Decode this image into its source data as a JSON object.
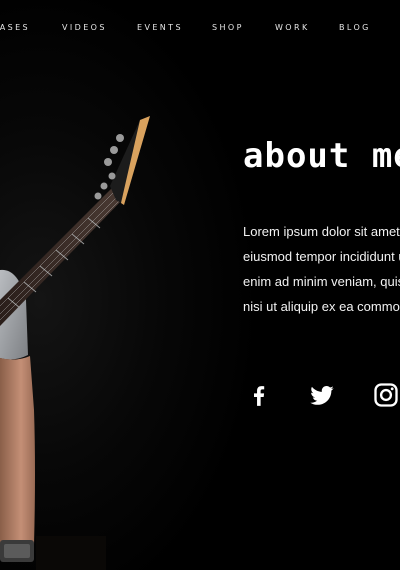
{
  "nav": {
    "items": [
      {
        "label": "RELEASES"
      },
      {
        "label": "VIDEOS"
      },
      {
        "label": "EVENTS"
      },
      {
        "label": "SHOP"
      },
      {
        "label": "WORK"
      },
      {
        "label": "BLOG"
      }
    ]
  },
  "about": {
    "title": "about me",
    "lines": [
      "Lorem ipsum dolor sit amet, consectetur adipiscing elit, sed do",
      "eiusmod tempor incididunt ut labore et dolore magna aliqua. Ut",
      "enim ad minim veniam, quis nostrud exercitation ullamco laboris",
      "nisi ut aliquip ex ea commodo consequat."
    ]
  },
  "social": {
    "icons": [
      "facebook-icon",
      "twitter-icon",
      "instagram-icon"
    ]
  },
  "colors": {
    "background": "#000000",
    "text": "#ffffff",
    "nav_text": "#e6e6e6"
  }
}
